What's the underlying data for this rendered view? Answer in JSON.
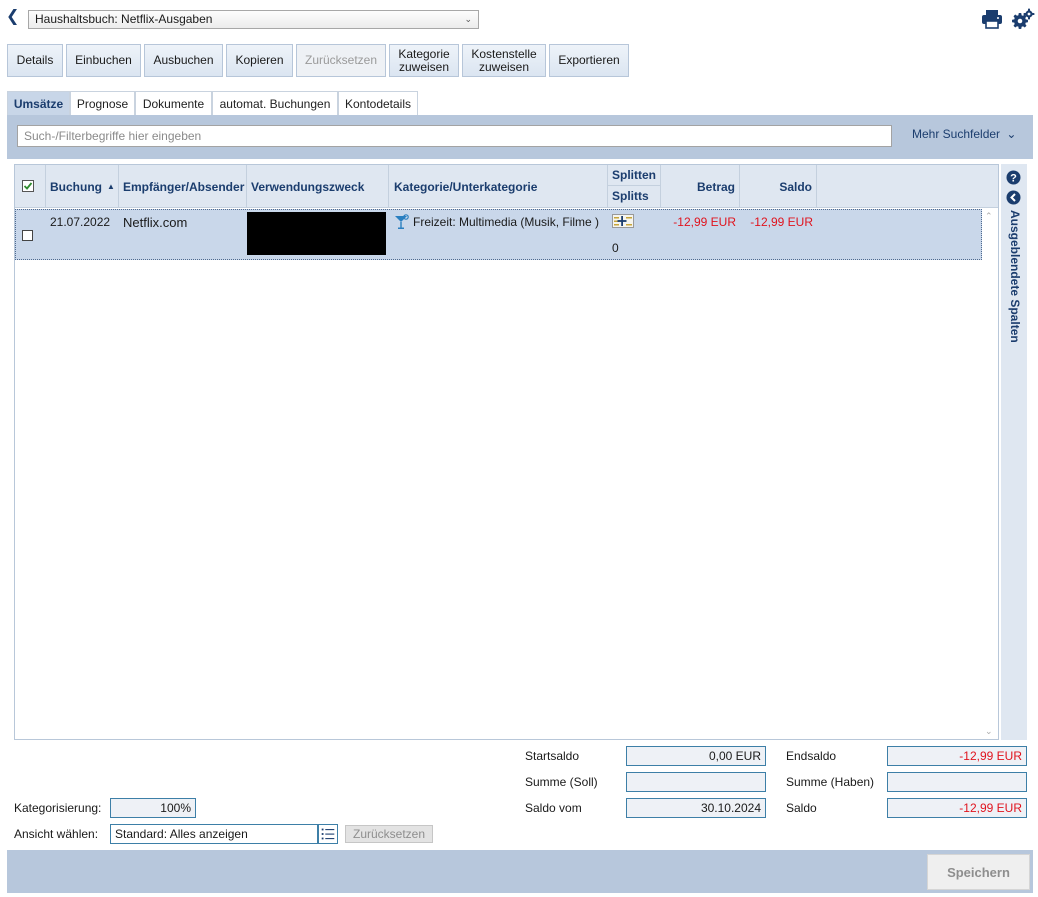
{
  "header": {
    "account_select": "Haushaltsbuch: Netflix-Ausgaben"
  },
  "toolbar": {
    "details": "Details",
    "einbuchen": "Einbuchen",
    "ausbuchen": "Ausbuchen",
    "kopieren": "Kopieren",
    "zuruecksetzen": "Zurücksetzen",
    "kategorie_l1": "Kategorie",
    "kategorie_l2": "zuweisen",
    "kostenstelle_l1": "Kostenstelle",
    "kostenstelle_l2": "zuweisen",
    "exportieren": "Exportieren"
  },
  "tabs": [
    {
      "label": "Umsätze",
      "active": true
    },
    {
      "label": "Prognose"
    },
    {
      "label": "Dokumente"
    },
    {
      "label": "automat. Buchungen"
    },
    {
      "label": "Kontodetails"
    }
  ],
  "search": {
    "placeholder": "Such-/Filterbegriffe hier eingeben",
    "more_fields": "Mehr Suchfelder"
  },
  "grid": {
    "columns": {
      "buchung": "Buchung",
      "empfaenger": "Empfänger/Absender",
      "verwendungszweck": "Verwendungszweck",
      "kategorie": "Kategorie/Unterkategorie",
      "splitten": "Splitten",
      "splitts": "Splitts",
      "betrag": "Betrag",
      "saldo": "Saldo"
    },
    "rows": [
      {
        "datum": "21.07.2022",
        "empfaenger": "Netflix.com",
        "kategorie": "Freizeit: Multimedia (Musik, Filme )",
        "splitts": "0",
        "betrag": "-12,99 EUR",
        "saldo": "-12,99 EUR"
      }
    ],
    "hidden_columns_label": "Ausgeblendete Spalten"
  },
  "summary": {
    "startsaldo_label": "Startsaldo",
    "startsaldo_value": "0,00 EUR",
    "endsaldo_label": "Endsaldo",
    "endsaldo_value": "-12,99 EUR",
    "summe_soll_label": "Summe (Soll)",
    "summe_soll_value": "",
    "summe_haben_label": "Summe (Haben)",
    "summe_haben_value": "",
    "saldo_vom_label": "Saldo vom",
    "saldo_vom_value": "30.10.2024",
    "saldo_label": "Saldo",
    "saldo_value": "-12,99 EUR"
  },
  "footer": {
    "kategorisierung_label": "Kategorisierung:",
    "kategorisierung_value": "100%",
    "ansicht_label": "Ansicht wählen:",
    "ansicht_value": "Standard: Alles anzeigen",
    "reset_label": "Zurücksetzen",
    "save_label": "Speichern"
  },
  "colors": {
    "accent": "#1b3d6e",
    "negative": "#e0141e",
    "band": "#b7c7dc"
  }
}
